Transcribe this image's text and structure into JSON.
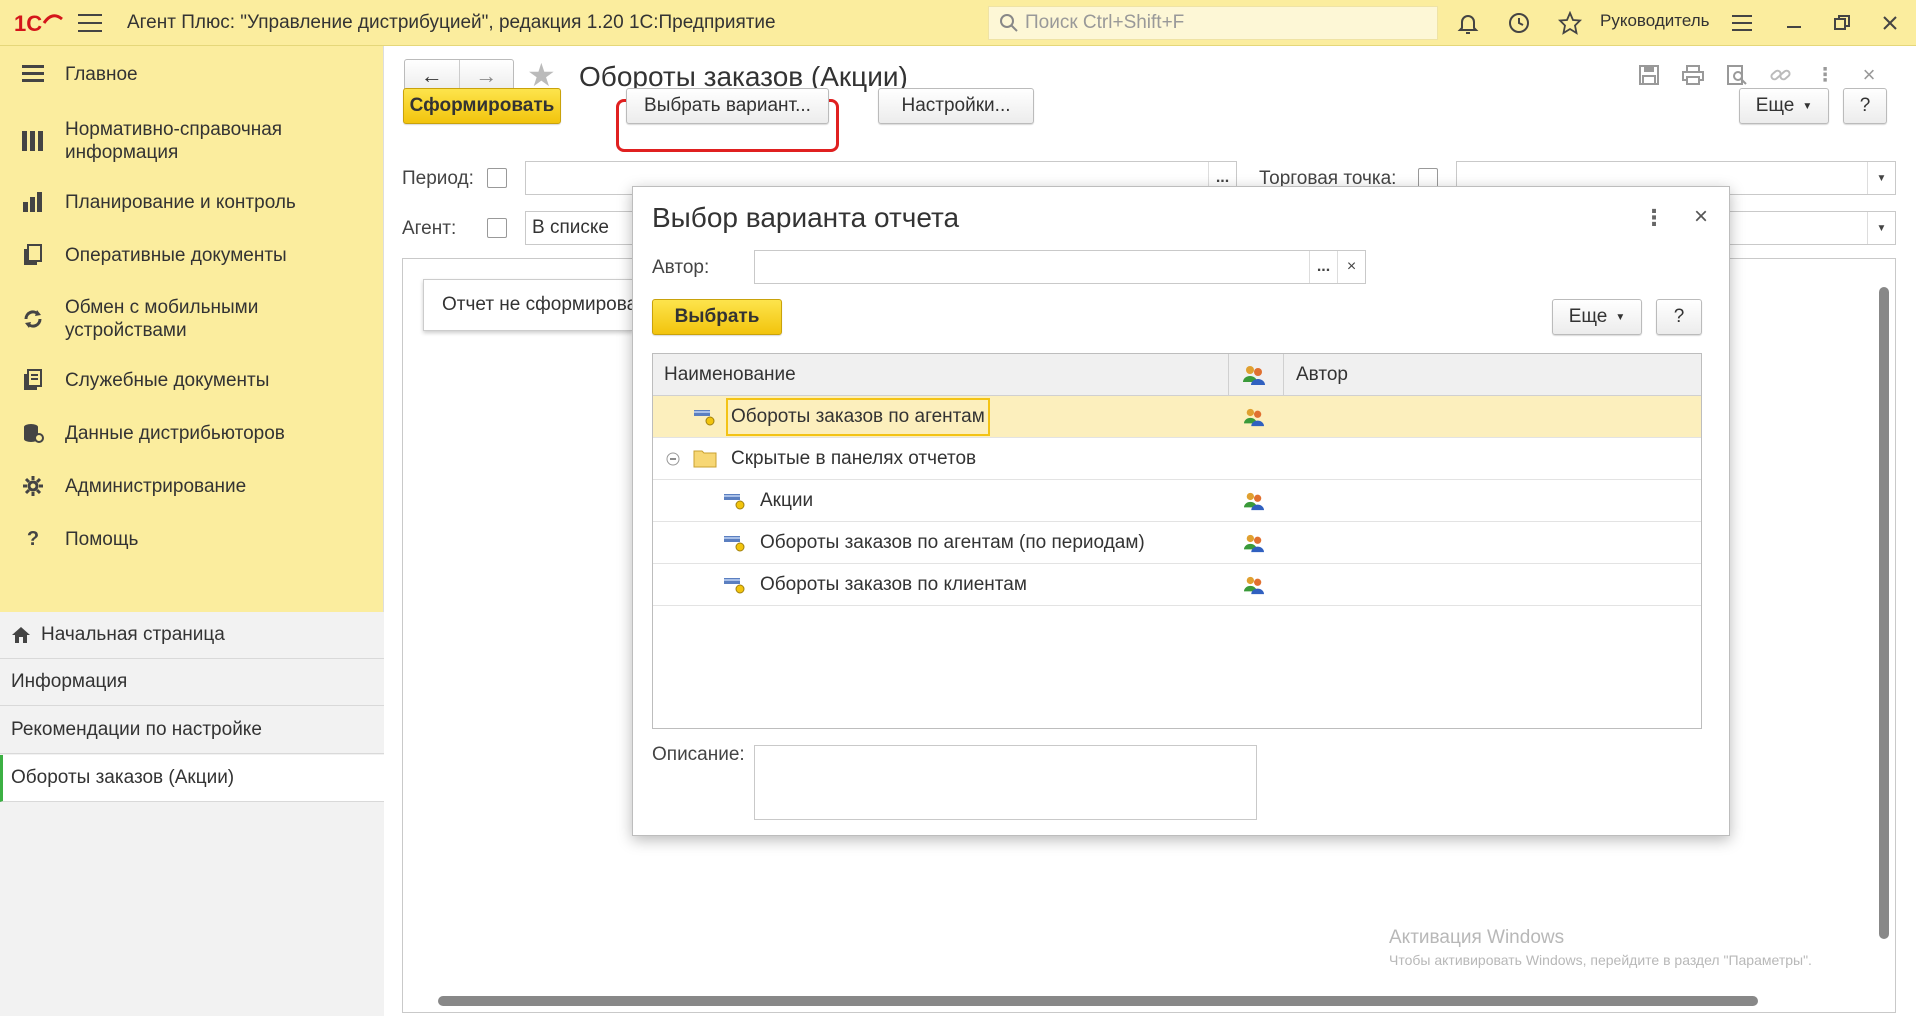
{
  "titlebar": {
    "app_title": "Агент Плюс: \"Управление дистрибуцией\", редакция 1.20 1С:Предприятие",
    "search_placeholder": "Поиск Ctrl+Shift+F",
    "user": "Руководитель"
  },
  "sidebar": {
    "items": [
      {
        "label": "Главное",
        "icon": "menu-lines-icon"
      },
      {
        "label": "Нормативно-справочная информация",
        "icon": "grid-book-icon"
      },
      {
        "label": "Планирование и контроль",
        "icon": "bar-chart-icon"
      },
      {
        "label": "Оперативные документы",
        "icon": "documents-icon"
      },
      {
        "label": "Обмен с мобильными устройствами",
        "icon": "sync-icon"
      },
      {
        "label": "Служебные документы",
        "icon": "service-docs-icon"
      },
      {
        "label": "Данные дистрибьюторов",
        "icon": "database-icon"
      },
      {
        "label": "Администрирование",
        "icon": "gear-icon"
      },
      {
        "label": "Помощь",
        "icon": "help-icon"
      }
    ],
    "open_windows": [
      {
        "label": "Начальная страница",
        "icon": "home-icon"
      },
      {
        "label": "Информация"
      },
      {
        "label": "Рекомендации по настройке"
      },
      {
        "label": "Обороты заказов (Акции)"
      }
    ]
  },
  "main": {
    "title": "Обороты заказов (Акции)",
    "generate_button": "Сформировать",
    "choose_variant_button": "Выбрать вариант...",
    "settings_button": "Настройки...",
    "more_button": "Еще",
    "help_button": "?",
    "period_label": "Период:",
    "period_value": "",
    "period_picker": "...",
    "outlet_label": "Торговая точка:",
    "outlet_value": "",
    "agent_label": "Агент:",
    "agent_value": "В списке",
    "report_status": "Отчет не сформирован",
    "watermark_title": "Активация Windows",
    "watermark_text": "Чтобы активировать Windows, перейдите в раздел \"Параметры\"."
  },
  "dialog": {
    "title": "Выбор варианта отчета",
    "author_label": "Автор:",
    "author_value": "",
    "author_picker": "...",
    "author_clear": "×",
    "select_button": "Выбрать",
    "more_button": "Еще",
    "help_button": "?",
    "columns": {
      "name": "Наименование",
      "author": "Автор"
    },
    "rows": [
      {
        "name": "Обороты заказов по агентам",
        "author": "",
        "level": 1,
        "type": "report-variant",
        "selected": true
      },
      {
        "name": "Скрытые в панелях отчетов",
        "author": "",
        "level": 0,
        "type": "folder",
        "expanded": true
      },
      {
        "name": "Акции",
        "author": "",
        "level": 2,
        "type": "report-variant"
      },
      {
        "name": "Обороты заказов по агентам (по периодам)",
        "author": "",
        "level": 2,
        "type": "report-variant"
      },
      {
        "name": "Обороты заказов по клиентам",
        "author": "",
        "level": 2,
        "type": "report-variant"
      }
    ],
    "description_label": "Описание:",
    "description_value": ""
  }
}
